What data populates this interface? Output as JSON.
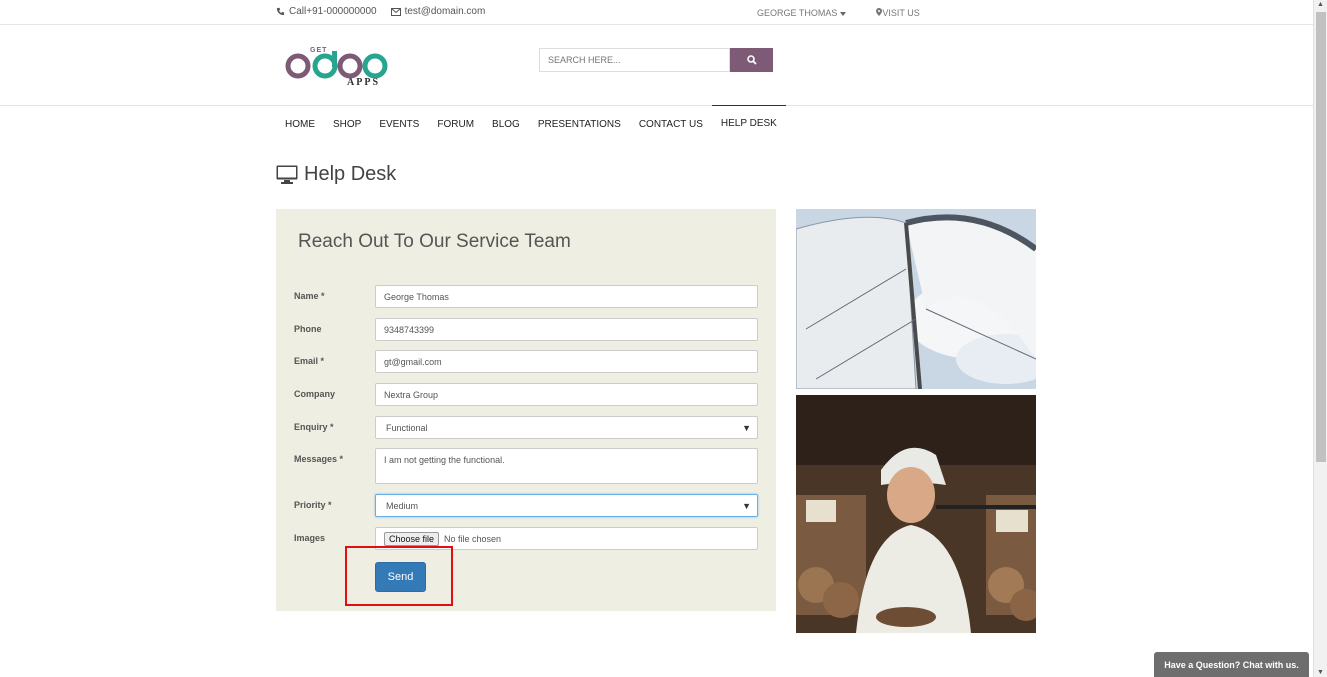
{
  "topbar": {
    "phone": "Call+91-000000000",
    "email": "test@domain.com",
    "user": "GEORGE THOMAS",
    "visit": "VISIT US"
  },
  "header": {
    "logo_get": "GET",
    "logo_apps": "APPS",
    "search_placeholder": "SEARCH HERE...",
    "brand_color": "#7d5a76",
    "accent_color": "#27a58f"
  },
  "nav": [
    {
      "label": "HOME"
    },
    {
      "label": "SHOP"
    },
    {
      "label": "EVENTS"
    },
    {
      "label": "FORUM"
    },
    {
      "label": "BLOG"
    },
    {
      "label": "PRESENTATIONS"
    },
    {
      "label": "CONTACT US"
    },
    {
      "label": "HELP DESK"
    }
  ],
  "page": {
    "title": "Help Desk"
  },
  "form": {
    "heading": "Reach Out To Our Service Team",
    "name_label": "Name *",
    "name_value": "George Thomas",
    "phone_label": "Phone",
    "phone_value": "9348743399",
    "email_label": "Email *",
    "email_value": "gt@gmail.com",
    "company_label": "Company",
    "company_value": "Nextra Group",
    "enquiry_label": "Enquiry *",
    "enquiry_value": "Functional",
    "messages_label": "Messages *",
    "messages_value": "I am not getting the functional.",
    "priority_label": "Priority *",
    "priority_value": "Medium",
    "images_label": "Images",
    "file_button": "Choose file",
    "file_status": "No file chosen",
    "send_label": "Send",
    "panel_color": "#eeeee2",
    "button_color": "#337ab7"
  },
  "chat": {
    "label": "Have a Question? Chat with us."
  }
}
